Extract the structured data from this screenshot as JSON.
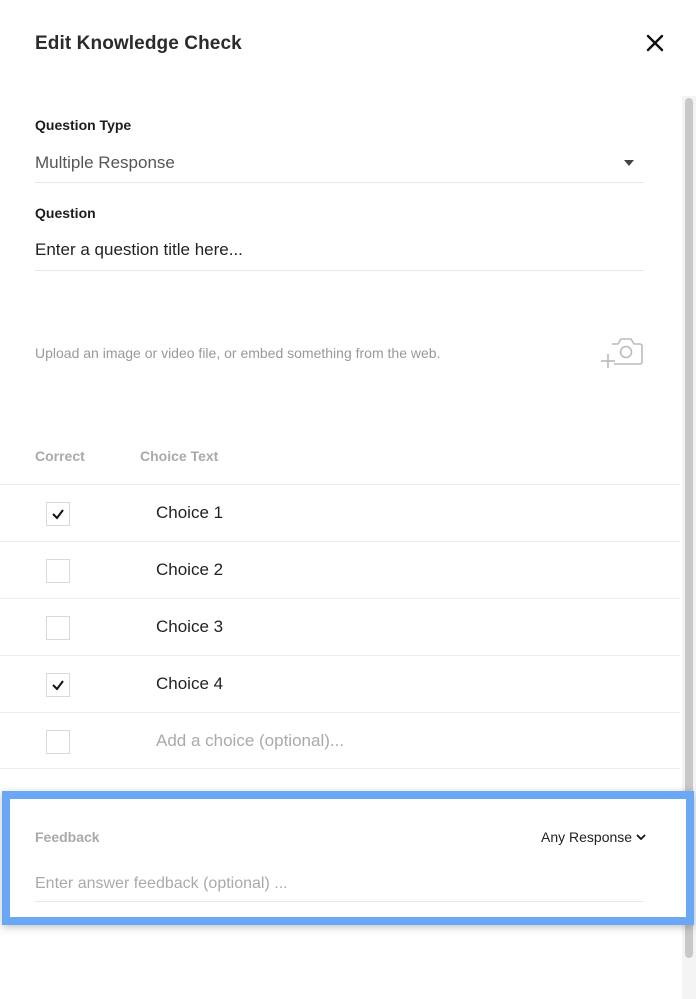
{
  "dialog": {
    "title": "Edit Knowledge Check",
    "close_icon": "close-icon"
  },
  "question_type": {
    "label": "Question Type",
    "value": "Multiple Response"
  },
  "question": {
    "label": "Question",
    "value": "Enter a question title here..."
  },
  "media": {
    "upload_text": "Upload an image or video file, or embed something from the web.",
    "icon": "add-camera-icon"
  },
  "choices": {
    "col_correct": "Correct",
    "col_text": "Choice Text",
    "items": [
      {
        "label": "Choice 1",
        "correct": true
      },
      {
        "label": "Choice 2",
        "correct": false
      },
      {
        "label": "Choice 3",
        "correct": false
      },
      {
        "label": "Choice 4",
        "correct": true
      }
    ],
    "add_placeholder": "Add a choice (optional)..."
  },
  "feedback": {
    "label": "Feedback",
    "response_select": "Any Response",
    "placeholder": "Enter answer feedback (optional) ...",
    "highlight_color": "#6aa8f5"
  }
}
